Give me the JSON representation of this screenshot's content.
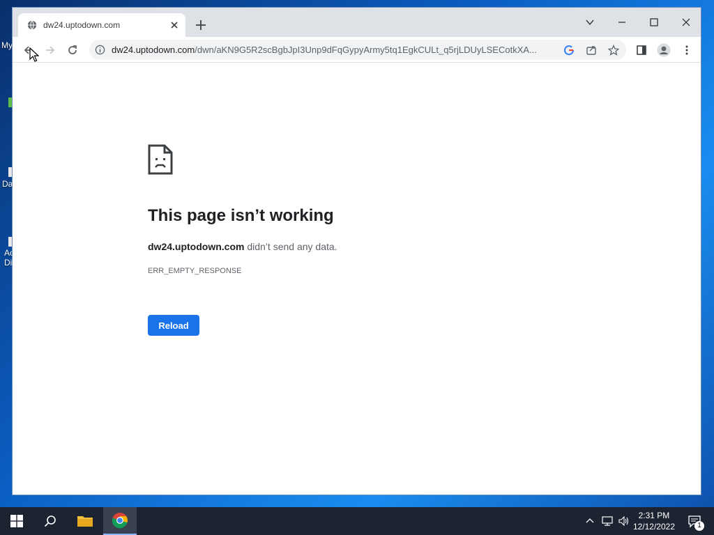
{
  "desktop": {
    "fragments": [
      "My",
      "Da",
      "Ac",
      "Di"
    ]
  },
  "browser": {
    "tab": {
      "title": "dw24.uptodown.com"
    },
    "toolbar": {
      "url_host": "dw24.uptodown.com",
      "url_path": "/dwn/aKN9G5R2scBgbJpI3Unp9dFqGypyArmy5tq1EgkCULt_q5rjLDUyLSECotkXA..."
    },
    "page": {
      "title": "This page isn’t working",
      "message_host": "dw24.uptodown.com",
      "message_rest": " didn’t send any data.",
      "error_code": "ERR_EMPTY_RESPONSE",
      "reload_label": "Reload"
    }
  },
  "taskbar": {
    "time": "2:31 PM",
    "date": "12/12/2022",
    "notification_count": "1"
  },
  "colors": {
    "accent": "#1a73e8",
    "chrome_frame": "#dee1e6",
    "taskbar": "#1c2331"
  }
}
